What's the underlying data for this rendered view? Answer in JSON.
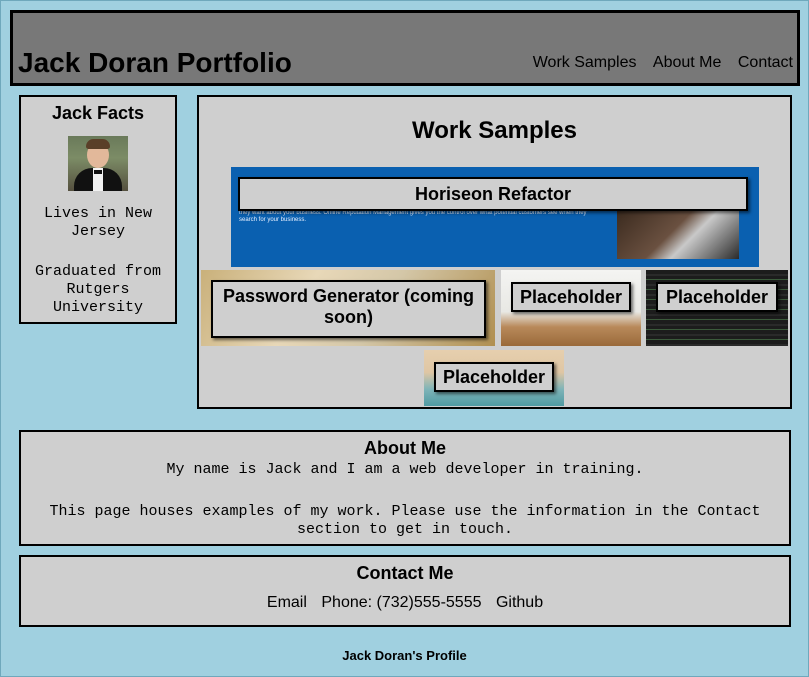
{
  "header": {
    "title": "Jack Doran Portfolio",
    "nav": [
      "Work Samples",
      "About Me",
      "Contact"
    ]
  },
  "facts": {
    "heading": "Jack Facts",
    "items": [
      "Lives in New Jersey",
      "Graduated from Rutgers University"
    ]
  },
  "work": {
    "heading": "Work Samples",
    "horiseon_label": "Horiseon Refactor",
    "horiseon_text": "they want about your business. Online Reputation Management gives you the control over what potential customers see when they search for your business.",
    "password_label": "Password Generator (coming soon)",
    "placeholder1": "Placeholder",
    "placeholder2": "Placeholder",
    "placeholder3": "Placeholder"
  },
  "about": {
    "heading": "About Me",
    "p1": "My name is Jack and I am a web developer in training.",
    "p2": "This page houses examples of my work. Please use the information in the Contact section to get in touch."
  },
  "contact": {
    "heading": "Contact Me",
    "email": "Email",
    "phone": "Phone: (732)555-5555",
    "github": "Github"
  },
  "footer": "Jack Doran's Profile",
  "colors": {
    "page_bg": "#a0d0e0",
    "header_bg": "#787878",
    "panel_bg": "#cfcfcf",
    "horiseon_blue": "#0a60b0"
  }
}
